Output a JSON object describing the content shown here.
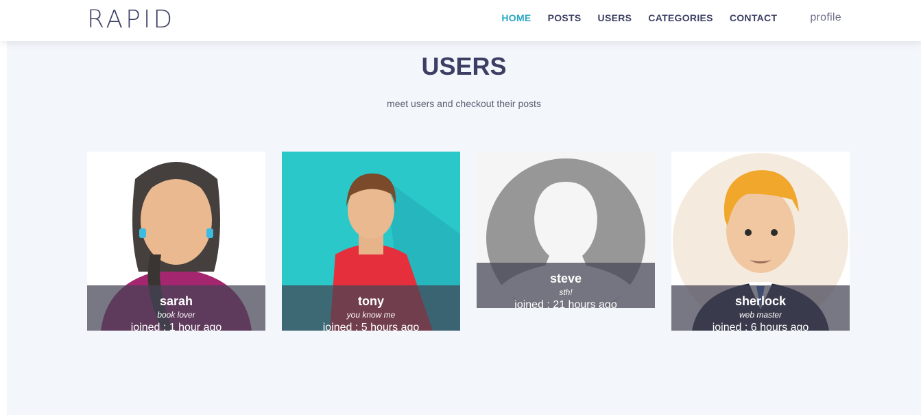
{
  "header": {
    "brand": "RAPID",
    "nav": [
      {
        "label": "HOME",
        "active": true
      },
      {
        "label": "POSTS",
        "active": false
      },
      {
        "label": "USERS",
        "active": false
      },
      {
        "label": "CATEGORIES",
        "active": false
      },
      {
        "label": "CONTACT",
        "active": false
      }
    ],
    "profile": "profile"
  },
  "main": {
    "title": "USERS",
    "subtitle": "meet users and checkout their posts"
  },
  "users": [
    {
      "name": "sarah",
      "bio": "book lover",
      "joined": "joined : 1 hour ago",
      "avatar": "female-avatar"
    },
    {
      "name": "tony",
      "bio": "you know me",
      "joined": "joined : 5 hours ago",
      "avatar": "male-avatar"
    },
    {
      "name": "steve",
      "bio": "sth!",
      "joined": "joined : 21 hours ago",
      "avatar": "default-avatar"
    },
    {
      "name": "sherlock",
      "bio": "web master",
      "joined": "joined : 6 hours ago",
      "avatar": "businessman-avatar"
    }
  ],
  "colors": {
    "accent": "#2aa8c4",
    "brand": "#3c3f63",
    "background": "#f3f6fb"
  }
}
